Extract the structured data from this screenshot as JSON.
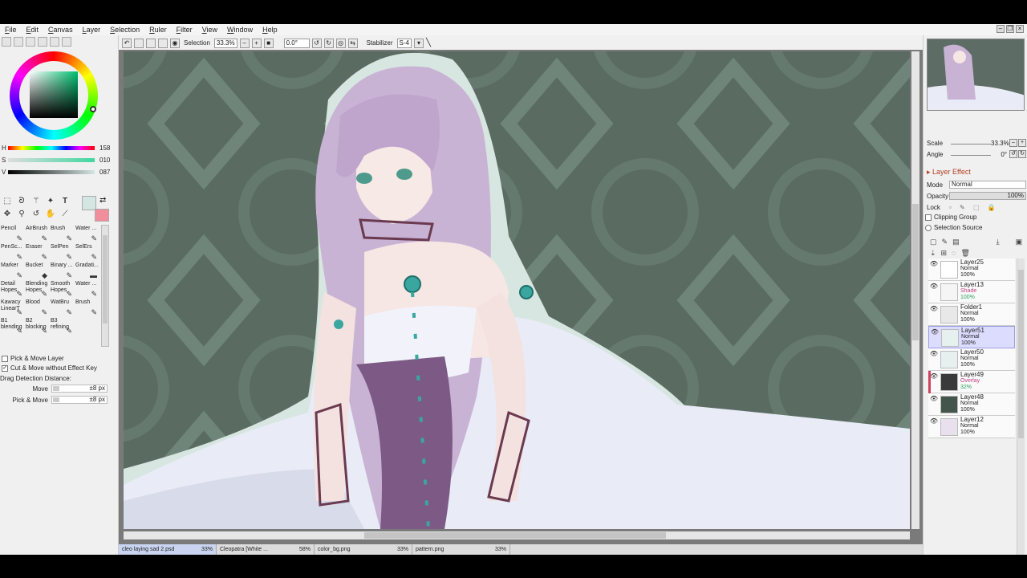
{
  "menu": [
    "File",
    "Edit",
    "Canvas",
    "Layer",
    "Selection",
    "Ruler",
    "Filter",
    "View",
    "Window",
    "Help"
  ],
  "toolbar": {
    "selection_label": "Selection",
    "zoom": "33.3%",
    "angle": "0.0°",
    "stabilizer_label": "Stabilizer",
    "stabilizer_value": "S-4"
  },
  "color": {
    "h_label": "H",
    "h_value": "158",
    "s_label": "S",
    "s_value": "010",
    "v_label": "V",
    "v_value": "087",
    "main_color": "#d4e6e2",
    "sub_color": "#f28d9b"
  },
  "brushes": [
    {
      "name": "Pencil",
      "icon": "✎"
    },
    {
      "name": "AirBrush",
      "icon": "✎"
    },
    {
      "name": "Brush",
      "icon": "✎"
    },
    {
      "name": "Water ...",
      "icon": "✎"
    },
    {
      "name": "PenSc...",
      "icon": "✎"
    },
    {
      "name": "Eraser",
      "icon": "✎"
    },
    {
      "name": "SelPen",
      "icon": "✎"
    },
    {
      "name": "SelErs",
      "icon": "✎"
    },
    {
      "name": "Marker",
      "icon": "✎"
    },
    {
      "name": "Bucket",
      "icon": "◆"
    },
    {
      "name": "Binary ...",
      "icon": "✎"
    },
    {
      "name": "Gradati...",
      "icon": "▬"
    },
    {
      "name": "Detail\nHopes",
      "icon": "✎"
    },
    {
      "name": "Blending\nHopes",
      "icon": "✎"
    },
    {
      "name": "Smooth\nHopes",
      "icon": "✎"
    },
    {
      "name": "Water ...",
      "icon": "✎"
    },
    {
      "name": "Kawacy\nLinearT",
      "icon": "✎"
    },
    {
      "name": "Blood",
      "icon": "✎"
    },
    {
      "name": "WatBru",
      "icon": "✎"
    },
    {
      "name": "Brush",
      "icon": "✎"
    },
    {
      "name": "B1\nblending",
      "icon": "✎"
    },
    {
      "name": "B2\nblocking",
      "icon": "✎"
    },
    {
      "name": "B3\nrefining",
      "icon": "✎"
    },
    {
      "name": "",
      "icon": ""
    }
  ],
  "options": {
    "pick_move_layer": "Pick & Move Layer",
    "cut_move": "Cut & Move without Effect Key",
    "drag_detection": "Drag Detection Distance:",
    "move_label": "Move",
    "move_value": "±8 px",
    "pick_move_label": "Pick & Move",
    "pick_move_value": "±8 px"
  },
  "navigator": {
    "scale_label": "Scale",
    "scale_value": "33.3%",
    "angle_label": "Angle",
    "angle_value": "0°"
  },
  "layer_panel": {
    "effect_header": "Layer Effect",
    "mode_label": "Mode",
    "mode_value": "Normal",
    "opacity_label": "Opacity",
    "opacity_value": "100%",
    "lock_label": "Lock",
    "clipping_group": "Clipping Group",
    "selection_source": "Selection Source"
  },
  "layers": [
    {
      "name": "Layer25",
      "mode": "Normal",
      "opacity": "100%",
      "thumb": "#ffffff",
      "selected": false,
      "mark": false,
      "colored": false
    },
    {
      "name": "Layer13",
      "mode": "Shade",
      "opacity": "100%",
      "thumb": "#f5f5f5",
      "selected": false,
      "mark": false,
      "colored": true
    },
    {
      "name": "Folder1",
      "mode": "Normal",
      "opacity": "100%",
      "thumb": "#e8e8e8",
      "selected": false,
      "mark": false,
      "colored": false
    },
    {
      "name": "Layer51",
      "mode": "Normal",
      "opacity": "100%",
      "thumb": "#e6f0ee",
      "selected": true,
      "mark": false,
      "colored": false
    },
    {
      "name": "Layer50",
      "mode": "Normal",
      "opacity": "100%",
      "thumb": "#e6f0ee",
      "selected": false,
      "mark": false,
      "colored": false
    },
    {
      "name": "Layer49",
      "mode": "Overlay",
      "opacity": "32%",
      "thumb": "#3a3a3a",
      "selected": false,
      "mark": true,
      "colored": true
    },
    {
      "name": "Layer48",
      "mode": "Normal",
      "opacity": "100%",
      "thumb": "#44564c",
      "selected": false,
      "mark": false,
      "colored": false
    },
    {
      "name": "Layer12",
      "mode": "Normal",
      "opacity": "100%",
      "thumb": "#e8e0ec",
      "selected": false,
      "mark": false,
      "colored": false
    }
  ],
  "doc_tabs": [
    {
      "name": "cleo laying sad 2.psd",
      "zoom": "33%",
      "active": true
    },
    {
      "name": "Cleopatra [White ...",
      "zoom": "58%",
      "active": false
    },
    {
      "name": "color_bg.png",
      "zoom": "33%",
      "active": false
    },
    {
      "name": "pattern.png",
      "zoom": "33%",
      "active": false
    }
  ],
  "canvas_colors": {
    "background": "#5a6b62",
    "pattern": "#6f8378",
    "hair": "#c9b3d4",
    "dress": "#e8eaf4",
    "skin": "#f6e6e4",
    "jewel": "#3aa6a0"
  }
}
